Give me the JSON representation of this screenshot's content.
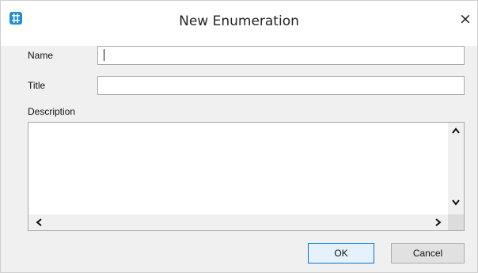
{
  "window": {
    "title": "New Enumeration",
    "close_glyph": "×",
    "app_icon": "app-grid-icon",
    "accent": "#1e8fd5"
  },
  "form": {
    "name_label": "Name",
    "name_value": "",
    "title_label": "Title",
    "title_value": "",
    "description_label": "Description",
    "description_value": ""
  },
  "scrollbars": {
    "up_glyph": "^",
    "down_glyph": "v",
    "left_glyph": "<",
    "right_glyph": ">"
  },
  "buttons": {
    "ok_label": "OK",
    "cancel_label": "Cancel"
  }
}
